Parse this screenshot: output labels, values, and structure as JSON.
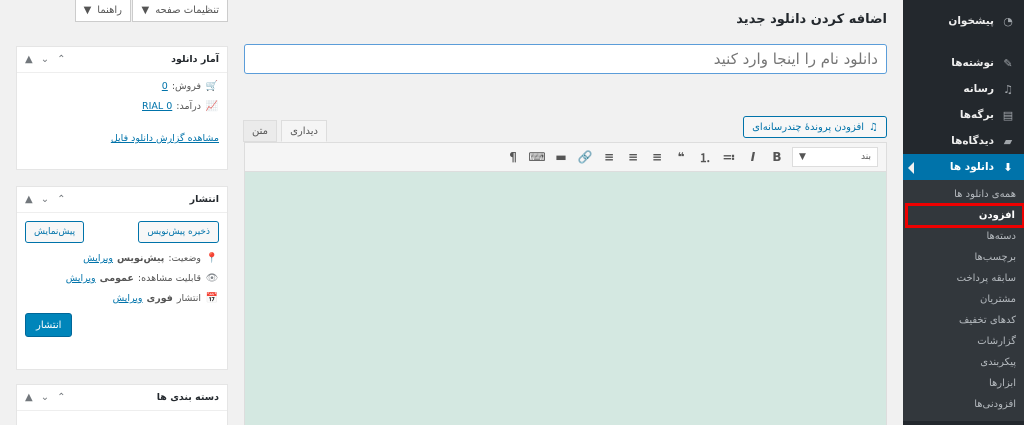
{
  "sidebar": {
    "items": [
      {
        "label": "پیشخوان",
        "icon": "dashboard-icon"
      },
      {
        "label": "نوشته‌ها",
        "icon": "pin-icon"
      },
      {
        "label": "رسانه",
        "icon": "media-icon"
      },
      {
        "label": "برگه‌ها",
        "icon": "pages-icon"
      },
      {
        "label": "دیدگاه‌ها",
        "icon": "comments-icon"
      },
      {
        "label": "دانلود ها",
        "icon": "download-icon"
      }
    ],
    "submenu": [
      "همه‌ی دانلود ها",
      "افزودن",
      "دسته‌ها",
      "برچسب‌ها",
      "سابقه پرداخت",
      "مشتریان",
      "کدهای تخفیف",
      "گزارشات",
      "پیکربندی",
      "ابزارها",
      "افزودنی‌ها"
    ]
  },
  "header": {
    "screen_options": "تنظیمات صفحه",
    "help": "راهنما",
    "title": "اضافه کردن دانلود جدید"
  },
  "editor": {
    "title_placeholder": "دانلود نام را اینجا وارد کنید",
    "add_media": "افزودن پروندهٔ چندرسانه‌ای",
    "tab_visual": "دیداری",
    "tab_text": "متن",
    "format_select": "بند",
    "toolbar": [
      "B",
      "I",
      "≔",
      "⒈",
      "❝",
      "≡",
      "≡",
      "≡",
      "🔗",
      "▬",
      "⌨",
      "¶"
    ]
  },
  "stats_box": {
    "title": "آمار دانلود",
    "sales_label": "فروش:",
    "sales_value": "0",
    "earnings_label": "درآمد:",
    "earnings_value": "RIAL 0",
    "report_link": "مشاهده گزارش دانلود فایل"
  },
  "publish_box": {
    "title": "انتشار",
    "save_draft": "ذخیره پیش‌نویس",
    "preview": "پیش‌نمایش",
    "status_label": "وضعیت:",
    "status_value": "پیش‌نویس",
    "visibility_label": "قابلیت مشاهده:",
    "visibility_value": "عمومی",
    "publish_label": "انتشار",
    "publish_value": "فوری",
    "edit": "ویرایش",
    "publish_button": "انتشار"
  },
  "category_box": {
    "title": "دسته بندی ها"
  }
}
